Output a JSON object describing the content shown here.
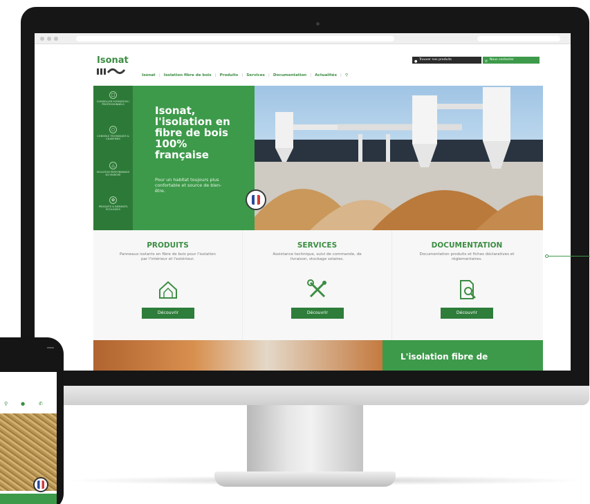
{
  "header": {
    "logo": "Isonat",
    "find_products": "Trouver nos produits",
    "contact": "Nous contacter"
  },
  "nav": {
    "items": [
      "Isonat",
      "Isolation fibre de bois",
      "Produits",
      "Services",
      "Documentation",
      "Actualités"
    ]
  },
  "sidebar": {
    "items": [
      {
        "label": "CONSEILLER FORMATION / PROFESSIONNELS"
      },
      {
        "label": "CONSEILS TECHNIQUES & CHANTIERS"
      },
      {
        "label": "ISOLATION PERFORMANCE DU MARCHÉ"
      },
      {
        "label": "PRODUITS & BIENFAITS ÉCOLOGIES"
      }
    ]
  },
  "hero": {
    "title": "Isonat,\nl'isolation en\nfibre de bois\n100%\nfrançaise",
    "subtitle": "Pour un habitat toujours plus confortable et source de bien-être."
  },
  "cards": [
    {
      "title": "PRODUITS",
      "desc": "Panneaux isolants en fibre de bois pour l'isolation par l'intérieur et l'extérieur.",
      "button": "Découvrir",
      "icon": "house-icon"
    },
    {
      "title": "SERVICES",
      "desc": "Assistance technique, suivi de commande, de livraison, stockage solaires.",
      "button": "Découvrir",
      "icon": "tools-icon"
    },
    {
      "title": "DOCUMENTATION",
      "desc": "Documentation produits et fiches déclaratives et réglementaires.",
      "button": "Découvrir",
      "icon": "document-search-icon"
    }
  ],
  "banner": {
    "title": "L'isolation fibre de"
  },
  "colors": {
    "brand_green": "#3d9a4a",
    "dark_green": "#2d7a38",
    "text_green": "#3c8d43"
  }
}
